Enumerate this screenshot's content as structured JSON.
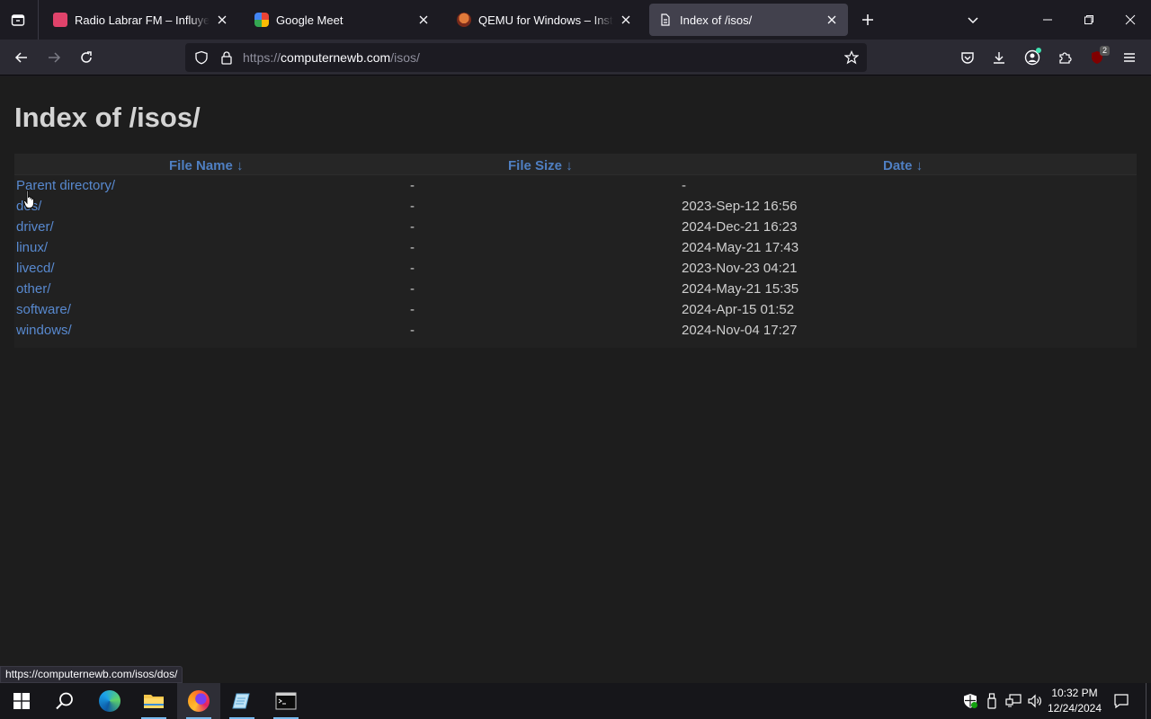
{
  "browser": {
    "tabs": [
      {
        "title": "Radio Labrar FM – Influye tus se",
        "favicon": "radio-favicon",
        "color": "#e0436b"
      },
      {
        "title": "Google Meet",
        "favicon": "meet-favicon",
        "color": "#34a853"
      },
      {
        "title": "QEMU for Windows – Installers",
        "favicon": "qemu-favicon",
        "color": "#c0392b"
      },
      {
        "title": "Index of /isos/",
        "favicon": "page-favicon",
        "active": true
      }
    ],
    "url": {
      "prefix": "https://",
      "host": "computernewb.com",
      "path": "/isos/"
    },
    "extension_badge": "2",
    "status_url": "https://computernewb.com/isos/dos/"
  },
  "page": {
    "title": "Index of /isos/",
    "headers": {
      "name": "File Name  ↓",
      "size": "File Size  ↓",
      "date": "Date  ↓"
    },
    "rows": [
      {
        "name": "Parent directory/",
        "size": "-",
        "date": "-"
      },
      {
        "name": "dos/",
        "size": "-",
        "date": "2023-Sep-12 16:56"
      },
      {
        "name": "driver/",
        "size": "-",
        "date": "2024-Dec-21 16:23"
      },
      {
        "name": "linux/",
        "size": "-",
        "date": "2024-May-21 17:43"
      },
      {
        "name": "livecd/",
        "size": "-",
        "date": "2023-Nov-23 04:21"
      },
      {
        "name": "other/",
        "size": "-",
        "date": "2024-May-21 15:35"
      },
      {
        "name": "software/",
        "size": "-",
        "date": "2024-Apr-15 01:52"
      },
      {
        "name": "windows/",
        "size": "-",
        "date": "2024-Nov-04 17:27"
      }
    ]
  },
  "taskbar": {
    "time": "10:32 PM",
    "date": "12/24/2024"
  },
  "colors": {
    "link": "#5889cf",
    "accent": "#76b9ed"
  }
}
